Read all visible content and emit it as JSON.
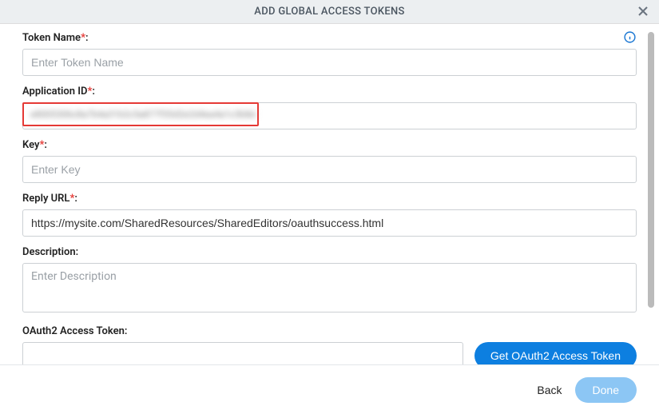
{
  "header": {
    "title": "ADD GLOBAL ACCESS TOKENS"
  },
  "fields": {
    "token_name": {
      "label": "Token Name",
      "placeholder": "Enter Token Name",
      "value": ""
    },
    "application_id": {
      "label": "Application ID",
      "value": "e8005306c8a7b4a31b2c5a877f35d2e2d4ea4a1c3b8e7a02"
    },
    "key": {
      "label": "Key",
      "placeholder": "Enter Key",
      "value": ""
    },
    "reply_url": {
      "label": "Reply URL",
      "value": "https://mysite.com/SharedResources/SharedEditors/oauthsuccess.html"
    },
    "description": {
      "label": "Description:",
      "placeholder": "Enter Description",
      "value": ""
    },
    "oauth_token": {
      "label": "OAuth2 Access Token:",
      "value": "",
      "button": "Get OAuth2 Access Token"
    }
  },
  "footer": {
    "back": "Back",
    "done": "Done"
  },
  "colon": ":",
  "asterisk": "*"
}
